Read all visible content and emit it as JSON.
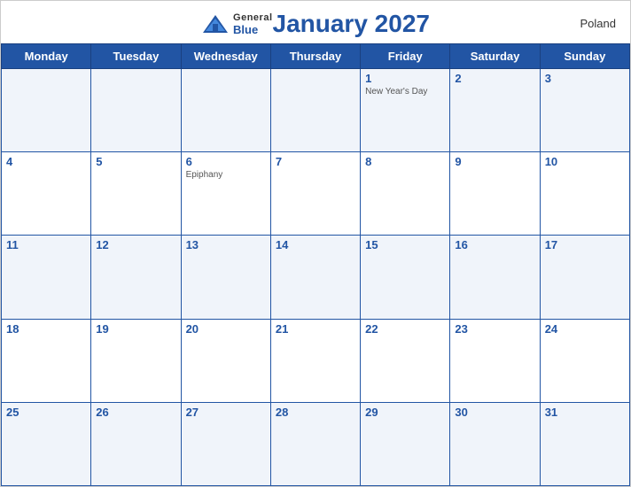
{
  "header": {
    "title": "January 2027",
    "country": "Poland",
    "logo": {
      "general": "General",
      "blue": "Blue"
    }
  },
  "days_of_week": [
    "Monday",
    "Tuesday",
    "Wednesday",
    "Thursday",
    "Friday",
    "Saturday",
    "Sunday"
  ],
  "weeks": [
    [
      {
        "day": "",
        "holiday": ""
      },
      {
        "day": "",
        "holiday": ""
      },
      {
        "day": "",
        "holiday": ""
      },
      {
        "day": "",
        "holiday": ""
      },
      {
        "day": "1",
        "holiday": "New Year's Day"
      },
      {
        "day": "2",
        "holiday": ""
      },
      {
        "day": "3",
        "holiday": ""
      }
    ],
    [
      {
        "day": "4",
        "holiday": ""
      },
      {
        "day": "5",
        "holiday": ""
      },
      {
        "day": "6",
        "holiday": "Epiphany"
      },
      {
        "day": "7",
        "holiday": ""
      },
      {
        "day": "8",
        "holiday": ""
      },
      {
        "day": "9",
        "holiday": ""
      },
      {
        "day": "10",
        "holiday": ""
      }
    ],
    [
      {
        "day": "11",
        "holiday": ""
      },
      {
        "day": "12",
        "holiday": ""
      },
      {
        "day": "13",
        "holiday": ""
      },
      {
        "day": "14",
        "holiday": ""
      },
      {
        "day": "15",
        "holiday": ""
      },
      {
        "day": "16",
        "holiday": ""
      },
      {
        "day": "17",
        "holiday": ""
      }
    ],
    [
      {
        "day": "18",
        "holiday": ""
      },
      {
        "day": "19",
        "holiday": ""
      },
      {
        "day": "20",
        "holiday": ""
      },
      {
        "day": "21",
        "holiday": ""
      },
      {
        "day": "22",
        "holiday": ""
      },
      {
        "day": "23",
        "holiday": ""
      },
      {
        "day": "24",
        "holiday": ""
      }
    ],
    [
      {
        "day": "25",
        "holiday": ""
      },
      {
        "day": "26",
        "holiday": ""
      },
      {
        "day": "27",
        "holiday": ""
      },
      {
        "day": "28",
        "holiday": ""
      },
      {
        "day": "29",
        "holiday": ""
      },
      {
        "day": "30",
        "holiday": ""
      },
      {
        "day": "31",
        "holiday": ""
      }
    ]
  ]
}
